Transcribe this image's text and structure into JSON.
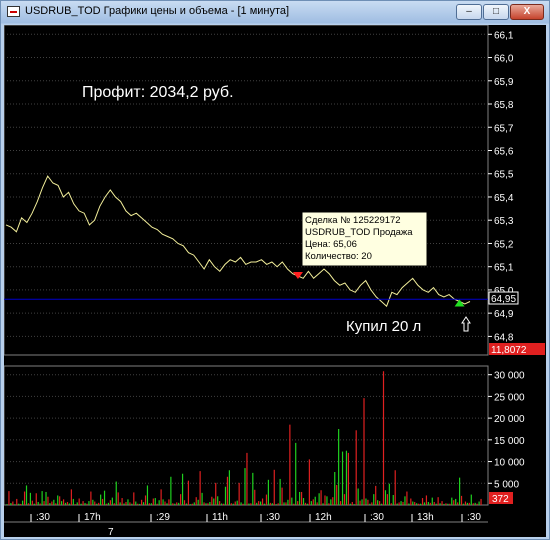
{
  "window": {
    "title": "USDRUB_TOD Графики цены и объема - [1 минута]",
    "min_label": "‒",
    "max_label": "□",
    "close_label": "X"
  },
  "price_panel": {
    "profit_text": "Профит:  2034,2 руб.",
    "bought_text": "Купил 20 л",
    "current_price_tag": "64,95",
    "bottom_tag": "11,8072",
    "colors": {
      "line": "#f2ee9a",
      "level": "#0000cc",
      "sell": "#ff2020",
      "buy": "#20e020",
      "text": "#ffffff"
    }
  },
  "tooltip": {
    "lines": [
      "Сделка № 125229172",
      "USDRUB_TOD Продажа",
      "Цена: 65,06",
      "Количество: 20"
    ]
  },
  "volume_panel": {
    "current_volume_tag": "372",
    "colors": {
      "up": "#1fd01f",
      "down": "#e02020"
    }
  },
  "time_axis": {
    "labels": [
      ":30",
      "17h",
      ":29",
      "11h",
      ":30",
      "12h",
      ":30",
      "13h",
      ":30"
    ],
    "lower_label": "7"
  },
  "chart_data": [
    {
      "type": "line",
      "name": "price",
      "y_ticks": [
        "66,1",
        "66,0",
        "65,9",
        "65,8",
        "65,7",
        "65,6",
        "65,5",
        "65,4",
        "65,3",
        "65,2",
        "65,1",
        "65,0",
        "64,9",
        "64,8"
      ],
      "ylim": [
        64.72,
        66.14
      ],
      "x_count": 90,
      "values": [
        65.28,
        65.27,
        65.25,
        65.31,
        65.29,
        65.33,
        65.38,
        65.44,
        65.49,
        65.46,
        65.45,
        65.4,
        65.42,
        65.37,
        65.34,
        65.33,
        65.28,
        65.3,
        65.36,
        65.4,
        65.43,
        65.4,
        65.38,
        65.34,
        65.32,
        65.33,
        65.31,
        65.29,
        65.27,
        65.26,
        65.24,
        65.23,
        65.22,
        65.2,
        65.19,
        65.16,
        65.15,
        65.12,
        65.09,
        65.13,
        65.1,
        65.08,
        65.11,
        65.13,
        65.12,
        65.14,
        65.11,
        65.12,
        65.12,
        65.13,
        65.11,
        65.12,
        65.1,
        65.12,
        65.09,
        65.07,
        65.06,
        65.05,
        65.08,
        65.05,
        65.07,
        65.09,
        65.07,
        65.04,
        65.02,
        65.03,
        65.0,
        64.99,
        65.02,
        65.04,
        65.0,
        64.97,
        64.95,
        64.93,
        64.99,
        64.98,
        65.01,
        65.03,
        65.05,
        65.02,
        65.0,
        64.99,
        65.01,
        64.98,
        64.97,
        64.98,
        64.96,
        64.95,
        64.94,
        64.95
      ],
      "level": 64.96,
      "sell_marker_index": 56,
      "buy_marker_index": 87
    },
    {
      "type": "bar",
      "name": "volume",
      "y_ticks": [
        "30 000",
        "25 000",
        "20 000",
        "15 000",
        "10 000",
        "5 000"
      ],
      "ylim": [
        0,
        32000
      ],
      "up": [
        200,
        450,
        180,
        300,
        1000,
        4500,
        2800,
        300,
        700,
        3200,
        3000,
        450,
        1200,
        2200,
        900,
        500,
        350,
        1400,
        600,
        300,
        450,
        900,
        1200,
        300,
        2400,
        3300,
        500,
        1700,
        5400,
        600,
        350,
        1300,
        300,
        800,
        250,
        650,
        4500,
        400,
        1600,
        1100,
        1300,
        400,
        6500,
        300,
        500,
        7200,
        350,
        200,
        600,
        1200,
        2800,
        400,
        700,
        1500,
        2000,
        350,
        4200,
        8000,
        300,
        1000,
        600,
        8500,
        350,
        7400,
        500,
        800,
        300,
        5800,
        400,
        200,
        6000,
        600,
        1200,
        1700,
        14300,
        3000,
        1600,
        300,
        900,
        1900,
        2700,
        400,
        2000,
        1300,
        7600,
        17500,
        12300,
        12500,
        300,
        200,
        3800,
        1300,
        1500,
        300,
        2500,
        1100,
        300,
        3400,
        4900,
        2300,
        350,
        900,
        2000,
        350,
        800,
        400,
        300,
        600,
        700,
        1700,
        300,
        400,
        250,
        300,
        1700,
        1400,
        6300,
        300,
        500,
        2400,
        500,
        800
      ],
      "down": [
        3200,
        800,
        1400,
        250,
        3100,
        400,
        1000,
        2700,
        350,
        900,
        1900,
        800,
        400,
        2000,
        1300,
        700,
        3600,
        200,
        1500,
        900,
        300,
        3100,
        800,
        500,
        1400,
        300,
        1100,
        400,
        2900,
        1600,
        700,
        600,
        2900,
        300,
        1200,
        2200,
        400,
        1500,
        300,
        3600,
        800,
        1300,
        400,
        600,
        2500,
        1100,
        5600,
        300,
        1800,
        7800,
        600,
        400,
        1900,
        5100,
        900,
        300,
        6500,
        400,
        800,
        5100,
        300,
        12000,
        400,
        3500,
        900,
        1500,
        2400,
        500,
        8100,
        400,
        4000,
        600,
        18500,
        300,
        900,
        3000,
        500,
        10500,
        1300,
        600,
        3400,
        2200,
        400,
        1800,
        4600,
        900,
        2500,
        12000,
        700,
        17200,
        1000,
        24600,
        1200,
        600,
        4400,
        900,
        30800,
        2500,
        400,
        8000,
        600,
        700,
        3100,
        1500,
        700,
        300,
        1600,
        2200,
        500,
        700,
        1800,
        900,
        400,
        300,
        1100,
        600,
        2100,
        800,
        500,
        400,
        300,
        1400
      ]
    }
  ]
}
